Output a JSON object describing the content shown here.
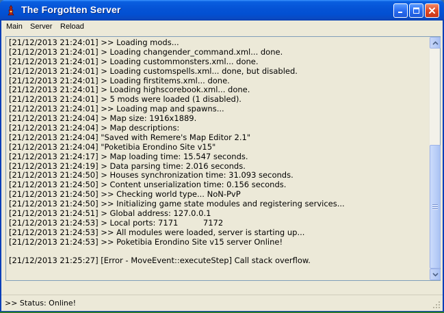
{
  "window": {
    "title": "The Forgotten Server",
    "controls": {
      "minimize": "minimize-icon",
      "maximize": "maximize-icon",
      "close": "close-icon"
    }
  },
  "menu": {
    "items": [
      "Main",
      "Server",
      "Reload"
    ]
  },
  "log": {
    "lines": [
      "[21/12/2013 21:24:01] >> Loading mods...",
      "[21/12/2013 21:24:01] > Loading changender_command.xml... done.",
      "[21/12/2013 21:24:01] > Loading custommonsters.xml... done.",
      "[21/12/2013 21:24:01] > Loading customspells.xml... done, but disabled.",
      "[21/12/2013 21:24:01] > Loading firstitems.xml... done.",
      "[21/12/2013 21:24:01] > Loading highscorebook.xml... done.",
      "[21/12/2013 21:24:01] > 5 mods were loaded (1 disabled).",
      "[21/12/2013 21:24:01] >> Loading map and spawns...",
      "[21/12/2013 21:24:04] > Map size: 1916x1889.",
      "[21/12/2013 21:24:04] > Map descriptions:",
      "[21/12/2013 21:24:04] \"Saved with Remere's Map Editor 2.1\"",
      "[21/12/2013 21:24:04] \"Poketibia Erondino Site v15\"",
      "[21/12/2013 21:24:17] > Map loading time: 15.547 seconds.",
      "[21/12/2013 21:24:19] > Data parsing time: 2.016 seconds.",
      "[21/12/2013 21:24:50] > Houses synchronization time: 31.093 seconds.",
      "[21/12/2013 21:24:50] > Content unserialization time: 0.156 seconds.",
      "[21/12/2013 21:24:50] >> Checking world type... NoN-PvP",
      "[21/12/2013 21:24:50] >> Initializing game state modules and registering services...",
      "[21/12/2013 21:24:51] > Global address: 127.0.0.1",
      "[21/12/2013 21:24:53] > Local ports: 7171          7172",
      "[21/12/2013 21:24:53] >> All modules were loaded, server is starting up...",
      "[21/12/2013 21:24:53] >> Poketibia Erondino Site v15 server Online!",
      "",
      "[21/12/2013 21:25:27] [Error - MoveEvent::executeStep] Call stack overflow."
    ]
  },
  "status": {
    "text": ">> Status: Online!"
  },
  "colors": {
    "titlebar": "#0553d6",
    "chrome": "#ece9d8",
    "close": "#e04a25"
  }
}
